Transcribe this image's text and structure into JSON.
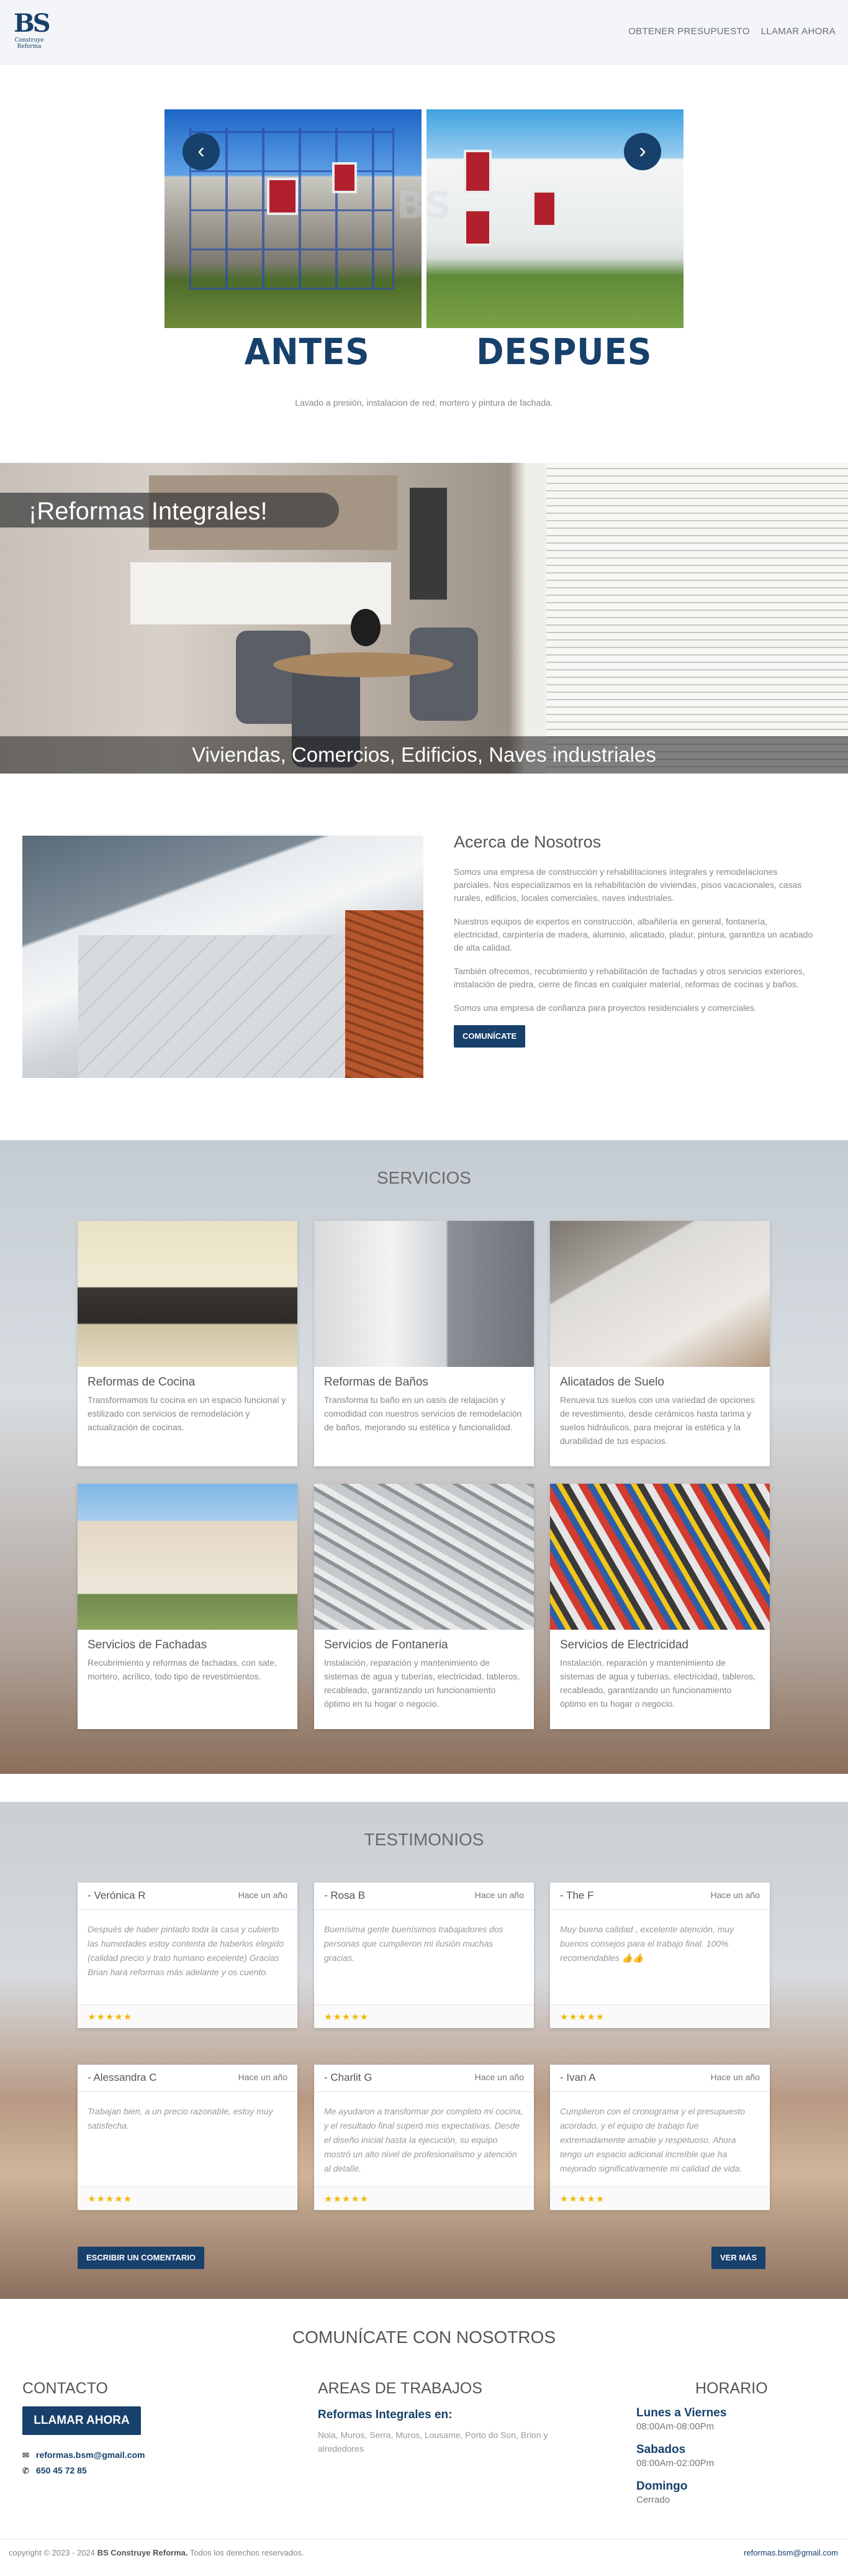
{
  "header": {
    "logo_text": "BS",
    "logo_sub": "Construye Reforma",
    "nav": [
      "OBTENER PRESUPUESTO",
      "LLAMAR AHORA"
    ]
  },
  "slider": {
    "label_left": "ANTES",
    "label_right": "DESPUES",
    "caption": "Lavado a presión, instalacion de red, mortero y pintura de fachada.",
    "prev_icon": "chevron-left-icon",
    "next_icon": "chevron-right-icon"
  },
  "hero": {
    "title": "¡Reformas Integrales!",
    "subtitle": "Viviendas, Comercios, Edificios, Naves industriales"
  },
  "about": {
    "title": "Acerca de Nosotros",
    "paragraphs": [
      "Somos una empresa de construcción y rehabilitaciones integrales y remodelaciones parciales. Nos especializamos en la rehabilitación de viviendas, pisos vacacionales, casas rurales, edificios, locales comerciales, naves industriales.",
      "Nuestros equipos de expertos en construcción, albañilería en general, fontanería, electricidad, carpintería de madera, aluminio, alicatado, pladur, pintura, garantiza un acabado de alta calidad.",
      "También ofrecemos, recubrimiento y rehabilitación de fachadas y otros servicios exteriores, instalación de piedra, cierre de fincas en cualquier material, reformas de cocinas y baños.",
      "Somos una empresa de confianza para proyectos residenciales y comerciales."
    ],
    "button": "COMUNÍCATE"
  },
  "services": {
    "title": "SERVICIOS",
    "items": [
      {
        "title": "Reformas de Cocina",
        "text": "Transformamos tu cocina en un espacio funcional y estilizado con servicios de remodelación y actualización de cocinas."
      },
      {
        "title": "Reformas de Baños",
        "text": "Transforma tu baño en un oasis de relajación y comodidad con nuestros servicios de remodelación de baños, mejorando su estética y funcionalidad."
      },
      {
        "title": "Alicatados de Suelo",
        "text": "Renueva tus suelos con una variedad de opciones de revestimiento, desde cerámicos hasta tarima y suelos hidráulicos, para mejorar la estética y la durabilidad de tus espacios."
      },
      {
        "title": "Servicios de Fachadas",
        "text": "Recubrimiento y reformas de fachadas, con sate, mortero, acrílico, todo tipo de revestimientos."
      },
      {
        "title": "Servicios de Fontaneria",
        "text": "Instalación, reparación y mantenimiento de sistemas de agua y tuberías, electricidad, tableros, recableado, garantizando un funcionamiento óptimo en tu hogar o negocio."
      },
      {
        "title": "Servicios de Electricidad",
        "text": "Instalación, reparación y mantenimiento de sistemas de agua y tuberías, electricidad, tableros, recableado, garantizando un funcionamiento óptimo en tu hogar o negocio."
      }
    ]
  },
  "testimonials": {
    "title": "TESTIMONIOS",
    "items": [
      {
        "name": "- Verónica R",
        "when": "Hace un año",
        "text": "Después de haber pintado toda la casa y cubierto las humedades estoy contenta de haberlos elegido (calidad precio y trato humano excelente) Gracias Brian hará reformas más adelante y os cuento.",
        "stars": "★★★★★"
      },
      {
        "name": "- Rosa B",
        "when": "Hace un año",
        "text": "Buenísima gente buenísimos trabajadores dos personas que cumplieron mi ilusión muchas gracias.",
        "stars": "★★★★★"
      },
      {
        "name": "- The F",
        "when": "Hace un año",
        "text": "Muy buena calidad , excelente atención, muy buenos consejos para el trabajo final. 100% recomendables 👍👍",
        "stars": "★★★★★"
      },
      {
        "name": "- Alessandra C",
        "when": "Hace un año",
        "text": "Trabajan bien, a un precio razonable, estoy muy satisfecha.",
        "stars": "★★★★★"
      },
      {
        "name": "- Charlit G",
        "when": "Hace un año",
        "text": "Me ayudaron a transformar por completo mi cocina, y el resultado final superó mis expectativas. Desde el diseño inicial hasta la ejecución, su equipo mostró un alto nivel de profesionalismo y atención al detalle.",
        "stars": "★★★★★"
      },
      {
        "name": "- Ivan A",
        "when": "Hace un año",
        "text": "Cumplieron con el cronograma y el presupuesto acordado, y el equipo de trabajo fue extremadamente amable y respetuoso. Ahora tengo un espacio adicional increíble que ha mejorado significativamente mi calidad de vida.",
        "stars": "★★★★★"
      }
    ],
    "write_button": "ESCRIBIR UN COMENTARIO",
    "more_button": "VER MÁS"
  },
  "contact": {
    "title": "COMUNÍCATE CON NOSOTROS",
    "col1_title": "CONTACTO",
    "call_button": "LLAMAR AHORA",
    "email": "reformas.bsm@gmail.com",
    "phone": "650 45 72 85",
    "col2_title": "AREAS DE TRABAJOS",
    "areas_heading": "Reformas Integrales en:",
    "areas_text": "Noia, Muros, Serra, Muros, Lousame, Porto do Son, Brion y alrededores",
    "col3_title": "HORARIO",
    "schedule": [
      {
        "day": "Lunes a Viernes",
        "hours": "08:00Am-08:00Pm"
      },
      {
        "day": "Sabados",
        "hours": "08:00Am-02:00Pm"
      },
      {
        "day": "Domingo",
        "hours": "Cerrado"
      }
    ]
  },
  "footer": {
    "copyright_prefix": "copyright © 2023 - 2024",
    "company": "BS Construye Reforma.",
    "rights": "Todos los derechos reservados.",
    "email": "reformas.bsm@gmail.com"
  },
  "colors": {
    "brand": "#17406b",
    "star": "#f2b80a"
  }
}
